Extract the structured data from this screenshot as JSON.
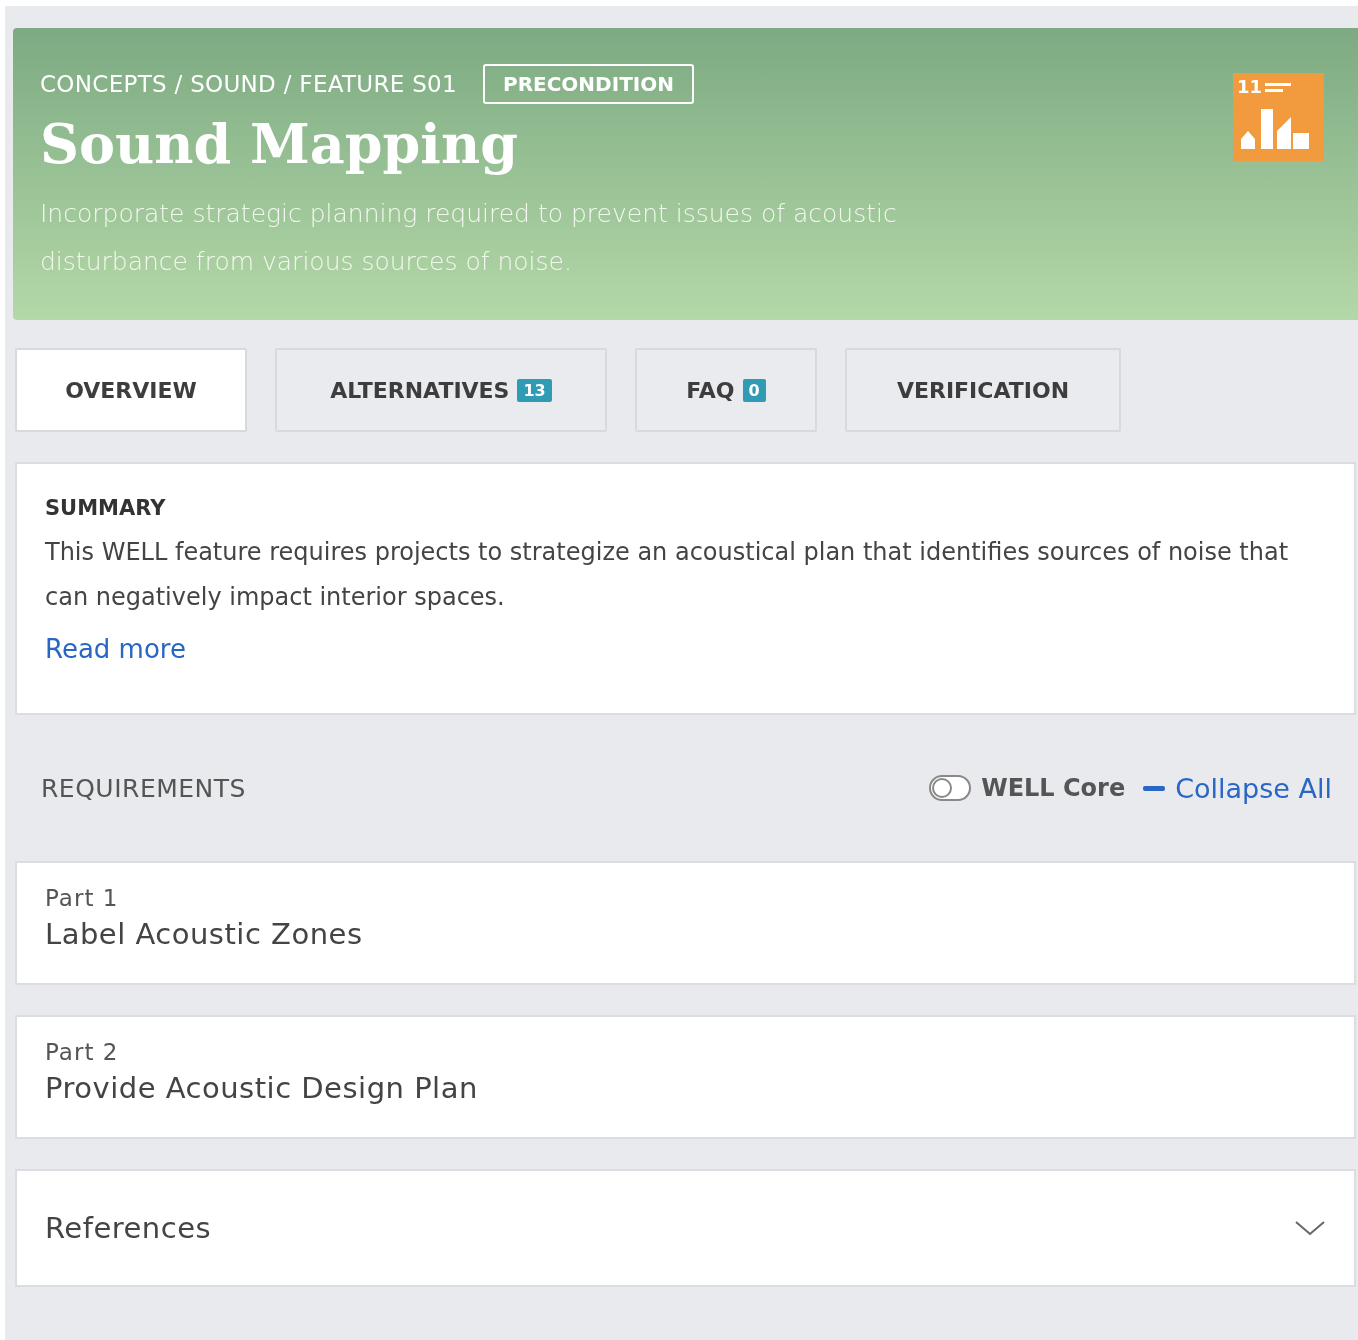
{
  "header": {
    "breadcrumb": "CONCEPTS / SOUND / FEATURE S01",
    "badge": "PRECONDITION",
    "title": "Sound Mapping",
    "description": "Incorporate strategic planning required to prevent issues of acoustic disturbance from various sources of noise.",
    "goal_number": "11"
  },
  "tabs": [
    {
      "label": "OVERVIEW",
      "selected": true
    },
    {
      "label": "ALTERNATIVES",
      "count": "13",
      "selected": false
    },
    {
      "label": "FAQ",
      "count": "0",
      "selected": false
    },
    {
      "label": "VERIFICATION",
      "selected": false
    }
  ],
  "summary": {
    "heading": "SUMMARY",
    "text": "This WELL feature requires projects to strategize an acoustical plan that identifies sources of noise that can negatively impact interior spaces.",
    "link": "Read more"
  },
  "requirements": {
    "heading": "REQUIREMENTS",
    "toggle": {
      "label": "WELL Core",
      "on": false
    },
    "collapse": "Collapse All",
    "parts": [
      {
        "number": "Part 1",
        "title": "Label Acoustic Zones"
      },
      {
        "number": "Part 2",
        "title": "Provide Acoustic Design Plan"
      }
    ]
  },
  "references": {
    "title": "References",
    "expanded": false
  }
}
